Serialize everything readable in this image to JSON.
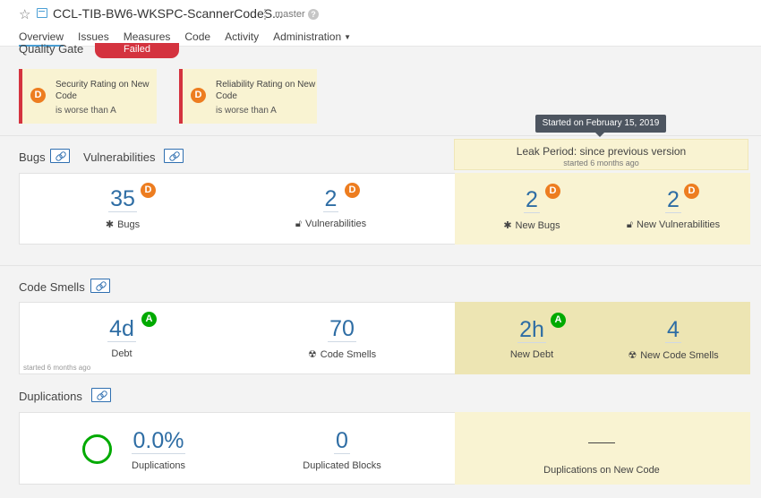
{
  "header": {
    "project_name": "CCL-TIB-BW6-WKSPC-ScannerCodeS...",
    "branch": "master",
    "nav": [
      "Overview",
      "Issues",
      "Measures",
      "Code",
      "Activity",
      "Administration"
    ]
  },
  "quality_gate": {
    "title": "Quality Gate",
    "status": "Failed",
    "conditions": [
      {
        "rating": "D",
        "label": "Security Rating on New Code",
        "sub": "is worse than A"
      },
      {
        "rating": "D",
        "label": "Reliability Rating on New Code",
        "sub": "is worse than A"
      }
    ]
  },
  "leak": {
    "tooltip": "Started on February 15, 2019",
    "title": "Leak Period: since previous version",
    "sub": "started 6 months ago"
  },
  "bugs_section": {
    "title_bugs": "Bugs",
    "title_vulns": "Vulnerabilities",
    "bugs": {
      "value": "35",
      "rating": "D",
      "label": "Bugs"
    },
    "vulns": {
      "value": "2",
      "rating": "D",
      "label": "Vulnerabilities"
    },
    "new_bugs": {
      "value": "2",
      "rating": "D",
      "label": "New Bugs"
    },
    "new_vulns": {
      "value": "2",
      "rating": "D",
      "label": "New Vulnerabilities"
    }
  },
  "smells_section": {
    "title": "Code Smells",
    "debt": {
      "value": "4d",
      "rating": "A",
      "label": "Debt"
    },
    "smells": {
      "value": "70",
      "label": "Code Smells"
    },
    "new_debt": {
      "value": "2h",
      "rating": "A",
      "label": "New Debt"
    },
    "new_smells": {
      "value": "4",
      "label": "New Code Smells"
    },
    "started_note": "started 6 months ago"
  },
  "dup_section": {
    "title": "Duplications",
    "duplications": {
      "value": "0.0%",
      "label": "Duplications"
    },
    "blocks": {
      "value": "0",
      "label": "Duplicated Blocks"
    },
    "new_dup": {
      "label": "Duplications on New Code"
    }
  },
  "colors": {
    "accent": "#4b9fd5",
    "failed": "#d4333f",
    "rating_d": "#ed7d20",
    "rating_a": "#00aa00",
    "leak_bg": "#f9f3d2"
  }
}
